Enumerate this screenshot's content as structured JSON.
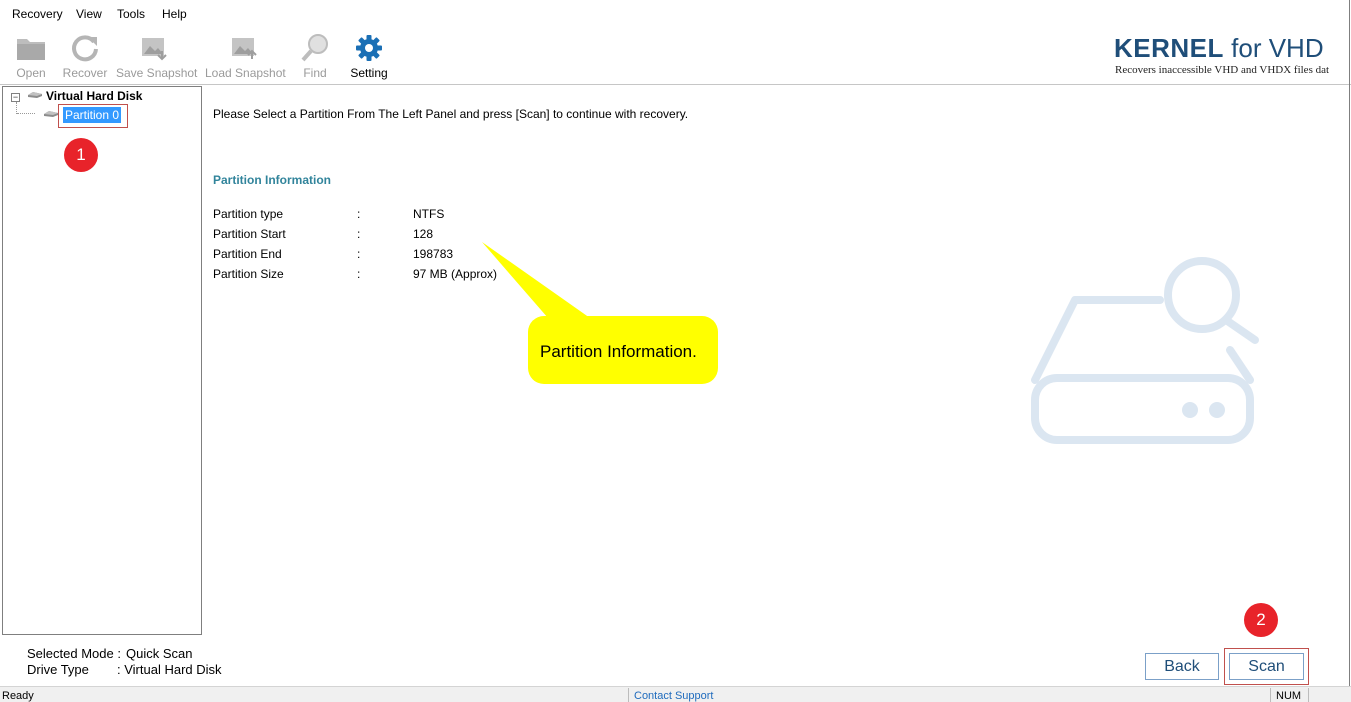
{
  "menu": {
    "items": [
      "Recovery",
      "View",
      "Tools",
      "Help"
    ]
  },
  "toolbar": {
    "open": "Open",
    "recover": "Recover",
    "save_snapshot": "Save Snapshot",
    "load_snapshot": "Load Snapshot",
    "find": "Find",
    "setting": "Setting"
  },
  "brand": {
    "kernel": "KERNEL",
    "product": " for VHD",
    "tagline": "Recovers inaccessible VHD and VHDX files dat"
  },
  "tree": {
    "root_label": "Virtual Hard Disk",
    "partition_label": "Partition 0",
    "toggle": "−"
  },
  "badges": {
    "one": "1",
    "two": "2"
  },
  "main": {
    "message": "Please Select a Partition From The Left Panel and press [Scan] to continue with recovery.",
    "info_title": "Partition Information",
    "rows": [
      {
        "key": "Partition type",
        "sep": ":",
        "value": "NTFS"
      },
      {
        "key": "Partition Start",
        "sep": ":",
        "value": "128"
      },
      {
        "key": "Partition End",
        "sep": ":",
        "value": "198783"
      },
      {
        "key": "Partition Size",
        "sep": ":",
        "value": "97 MB (Approx)"
      }
    ],
    "callout": "Partition Information."
  },
  "status": {
    "mode_key": "Selected Mode :",
    "mode_value": "Quick Scan",
    "drive_key": "Drive Type",
    "drive_value": ": Virtual Hard Disk"
  },
  "buttons": {
    "back": "Back",
    "scan": "Scan"
  },
  "statusbar": {
    "ready": "Ready",
    "contact": "Contact Support",
    "num": "NUM"
  },
  "colors": {
    "accent_blue": "#1f4e79",
    "info_title": "#31849b",
    "selection": "#3399ff",
    "badge_red": "#e8232a",
    "callout_yellow": "#ffff00",
    "watermark": "#dbe6f1",
    "setting_icon": "#1a6fb5"
  },
  "icons": {
    "open": "folder-icon",
    "recover": "refresh-icon",
    "save_snapshot": "image-save-icon",
    "load_snapshot": "image-load-icon",
    "find": "magnifier-icon",
    "setting": "gear-icon"
  }
}
